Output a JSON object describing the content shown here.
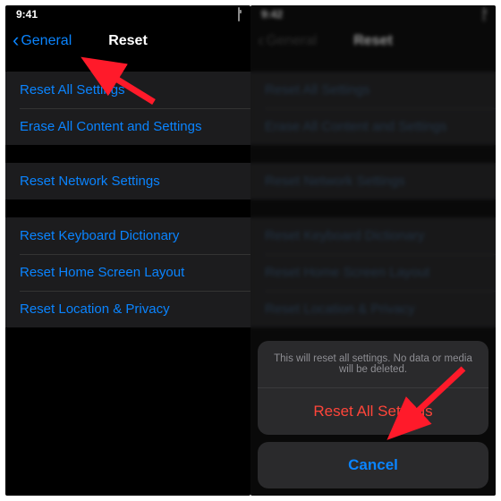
{
  "status": {
    "time_left": "9:41",
    "time_right": "9:42"
  },
  "nav": {
    "back": "General",
    "title": "Reset"
  },
  "groups": [
    {
      "items": [
        "Reset All Settings",
        "Erase All Content and Settings"
      ]
    },
    {
      "items": [
        "Reset Network Settings"
      ]
    },
    {
      "items": [
        "Reset Keyboard Dictionary",
        "Reset Home Screen Layout",
        "Reset Location & Privacy"
      ]
    }
  ],
  "sheet": {
    "message": "This will reset all settings. No data or media will be deleted.",
    "action": "Reset All Settings",
    "cancel": "Cancel"
  }
}
